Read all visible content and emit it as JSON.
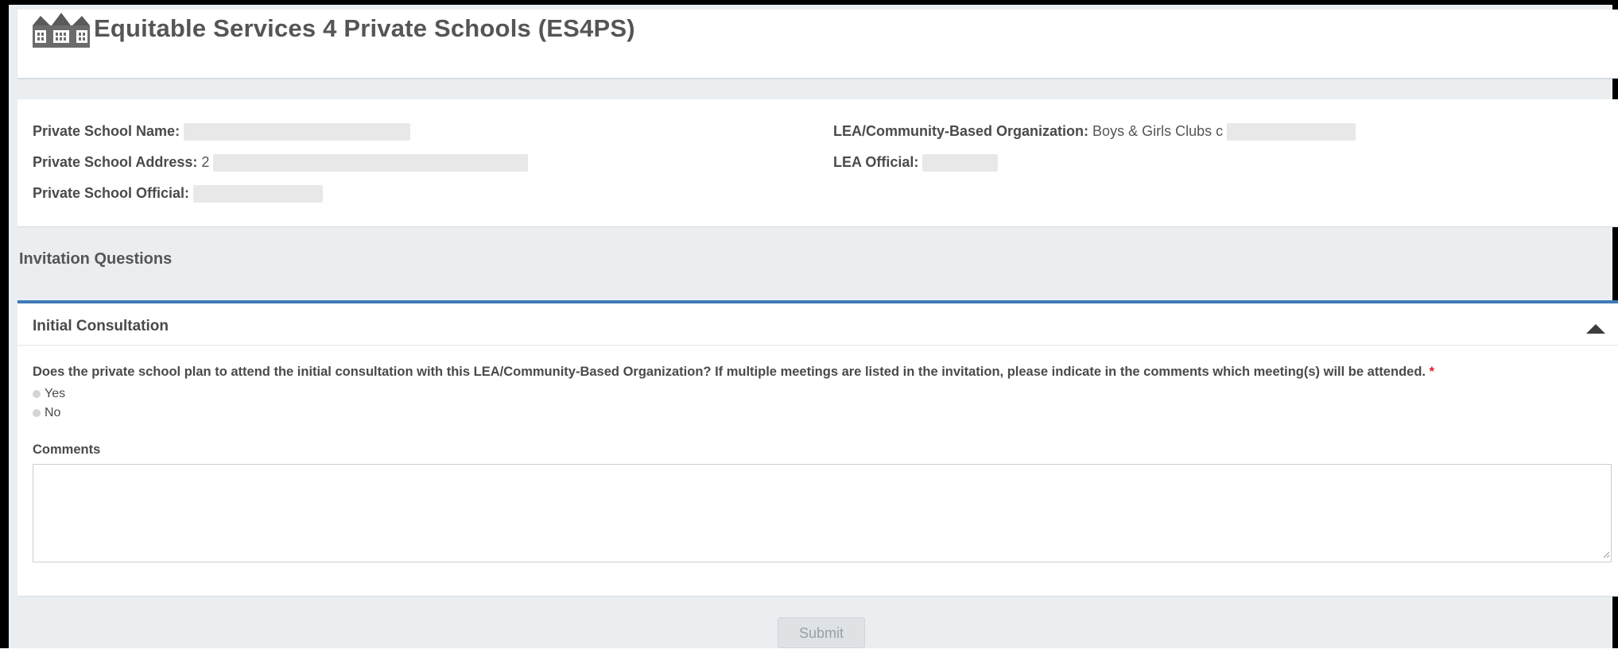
{
  "header": {
    "title": "Equitable Services 4 Private Schools (ES4PS)",
    "logo_icon": "school-buildings-icon"
  },
  "info": {
    "school_name_label": "Private School Name:",
    "school_address_label": "Private School Address:",
    "school_address_value": "2",
    "school_official_label": "Private School Official:",
    "lea_org_label": "LEA/Community-Based Organization:",
    "lea_org_value": "Boys & Girls Clubs c",
    "lea_official_label": "LEA Official:"
  },
  "section": {
    "heading": "Invitation Questions"
  },
  "panel": {
    "title": "Initial Consultation",
    "question": "Does the private school plan to attend the initial consultation with this LEA/Community-Based Organization? If multiple meetings are listed in the invitation, please indicate in the comments which meeting(s) will be attended.",
    "required_mark": "*",
    "options": [
      "Yes",
      "No"
    ],
    "comments_label": "Comments",
    "comments_value": ""
  },
  "actions": {
    "submit_label": "Submit"
  },
  "colors": {
    "accent": "#3f7ab8",
    "required": "#d9232d",
    "background": "#ebeef1"
  }
}
